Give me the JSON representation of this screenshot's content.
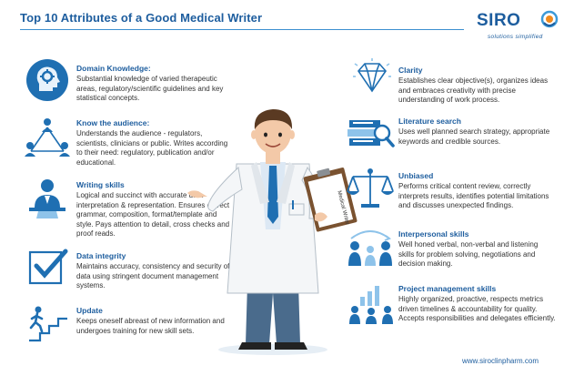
{
  "title": "Top 10 Attributes of a Good Medical Writer",
  "logo": {
    "name": "SIRO",
    "tagline": "solutions simplified"
  },
  "attributes_left": [
    {
      "title": "Domain Knowledge:",
      "text": "Substantial knowledge of varied therapeutic areas, regulatory/scientific guidelines and key statistical concepts.",
      "icon": "gear-head-icon"
    },
    {
      "title": "Know the audience:",
      "text": "Understands the audience - regulators, scientists, clinicians or public. Writes according to their need: regulatory, publication and/or educational.",
      "icon": "audience-network-icon"
    },
    {
      "title": "Writing skills",
      "text": "Logical and succinct with accurate data interpretation & representation. Ensures correct grammar, composition, format/template and style. Pays attention to detail, cross checks and proof reads.",
      "icon": "writer-icon"
    },
    {
      "title": "Data integrity",
      "text": "Maintains accuracy, consistency and security of data using stringent document management systems.",
      "icon": "checkmark-icon"
    },
    {
      "title": "Update",
      "text": "Keeps oneself abreast of new information and undergoes training for new skill sets.",
      "icon": "stairs-climb-icon"
    }
  ],
  "attributes_right": [
    {
      "title": "Clarity",
      "text": "Establishes clear objective(s), organizes ideas and embraces creativity with precise understanding of work process.",
      "icon": "diamond-icon"
    },
    {
      "title": "Literature search",
      "text": "Uses well planned search strategy, appropriate keywords and credible sources.",
      "icon": "books-search-icon"
    },
    {
      "title": "Unbiased",
      "text": "Performs critical content review, correctly interprets results, identifies potential limitations and discusses unexpected findings.",
      "icon": "balance-scale-icon"
    },
    {
      "title": "Interpersonal skills",
      "text": "Well honed verbal, non-verbal and listening skills for problem solving, negotiations and decision making.",
      "icon": "people-communication-icon"
    },
    {
      "title": "Project management skills",
      "text": "Highly organized, proactive, respects metrics driven timelines & accountability for quality. Accepts responsibilities and delegates efficiently.",
      "icon": "team-chart-icon"
    }
  ],
  "clipboard_label": "Medical Writer",
  "website": "www.siroclinpharm.com",
  "colors": {
    "brand_blue": "#1d5d9e",
    "icon_blue": "#1f6fb2",
    "light_blue": "#8ec3ea"
  }
}
